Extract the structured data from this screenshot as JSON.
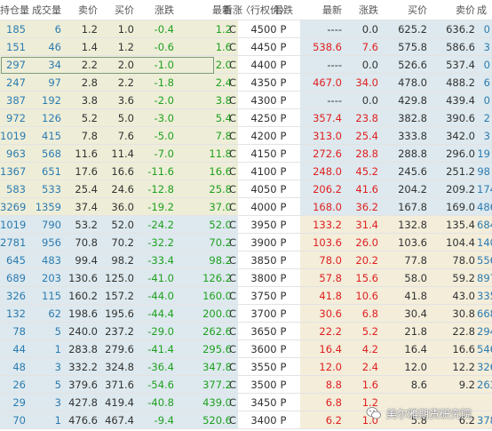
{
  "headers": [
    "持仓量",
    "成交量",
    "卖价",
    "买价",
    "涨跌",
    "最新",
    "看涨",
    "〈行权价〉",
    "看跌",
    "最新",
    "涨跌",
    "买价",
    "卖价",
    "成"
  ],
  "rows": [
    {
      "cOI": "185",
      "cVol": "6",
      "cAsk": "1.2",
      "cBid": "1.0",
      "cChg": "-0.4",
      "cLast": "1.2",
      "c": "C",
      "k": "4500",
      "p": "P",
      "pLast": "----",
      "pChg": "0.0",
      "pBid": "625.2",
      "pAsk": "636.2",
      "pVol": "0"
    },
    {
      "cOI": "151",
      "cVol": "46",
      "cAsk": "1.4",
      "cBid": "1.2",
      "cChg": "-0.6",
      "cLast": "1.6",
      "c": "C",
      "k": "4450",
      "p": "P",
      "pLast": "538.6",
      "pChg": "7.6",
      "pBid": "575.8",
      "pAsk": "586.6",
      "pVol": "3"
    },
    {
      "cOI": "297",
      "cVol": "34",
      "cAsk": "2.2",
      "cBid": "2.0",
      "cChg": "-1.0",
      "cLast": "2.0",
      "c": "C",
      "k": "4400",
      "p": "P",
      "pLast": "----",
      "pChg": "0.0",
      "pBid": "526.6",
      "pAsk": "537.4",
      "pVol": "0"
    },
    {
      "cOI": "247",
      "cVol": "97",
      "cAsk": "2.8",
      "cBid": "2.2",
      "cChg": "-1.8",
      "cLast": "2.4",
      "c": "C",
      "k": "4350",
      "p": "P",
      "pLast": "467.0",
      "pChg": "34.0",
      "pBid": "478.0",
      "pAsk": "488.2",
      "pVol": "6"
    },
    {
      "cOI": "387",
      "cVol": "192",
      "cAsk": "3.8",
      "cBid": "3.6",
      "cChg": "-2.0",
      "cLast": "3.8",
      "c": "C",
      "k": "4300",
      "p": "P",
      "pLast": "----",
      "pChg": "0.0",
      "pBid": "429.8",
      "pAsk": "439.4",
      "pVol": "0"
    },
    {
      "cOI": "972",
      "cVol": "126",
      "cAsk": "5.2",
      "cBid": "5.0",
      "cChg": "-3.0",
      "cLast": "5.4",
      "c": "C",
      "k": "4250",
      "p": "P",
      "pLast": "357.4",
      "pChg": "23.8",
      "pBid": "382.8",
      "pAsk": "390.6",
      "pVol": "2"
    },
    {
      "cOI": "1019",
      "cVol": "415",
      "cAsk": "7.8",
      "cBid": "7.6",
      "cChg": "-5.0",
      "cLast": "7.8",
      "c": "C",
      "k": "4200",
      "p": "P",
      "pLast": "313.0",
      "pChg": "25.4",
      "pBid": "333.8",
      "pAsk": "342.0",
      "pVol": "3"
    },
    {
      "cOI": "963",
      "cVol": "568",
      "cAsk": "11.6",
      "cBid": "11.4",
      "cChg": "-7.0",
      "cLast": "11.8",
      "c": "C",
      "k": "4150",
      "p": "P",
      "pLast": "272.6",
      "pChg": "28.8",
      "pBid": "288.8",
      "pAsk": "296.0",
      "pVol": "19"
    },
    {
      "cOI": "1367",
      "cVol": "651",
      "cAsk": "17.6",
      "cBid": "16.6",
      "cChg": "-11.6",
      "cLast": "16.6",
      "c": "C",
      "k": "4100",
      "p": "P",
      "pLast": "248.0",
      "pChg": "45.2",
      "pBid": "245.6",
      "pAsk": "251.2",
      "pVol": "98"
    },
    {
      "cOI": "583",
      "cVol": "533",
      "cAsk": "25.4",
      "cBid": "24.6",
      "cChg": "-12.8",
      "cLast": "25.8",
      "c": "C",
      "k": "4050",
      "p": "P",
      "pLast": "206.2",
      "pChg": "41.6",
      "pBid": "204.2",
      "pAsk": "209.2",
      "pVol": "174"
    },
    {
      "cOI": "3269",
      "cVol": "1359",
      "cAsk": "37.4",
      "cBid": "36.0",
      "cChg": "-19.2",
      "cLast": "37.0",
      "c": "C",
      "k": "4000",
      "p": "P",
      "pLast": "168.0",
      "pChg": "36.2",
      "pBid": "167.8",
      "pAsk": "169.0",
      "pVol": "486"
    },
    {
      "cOI": "1019",
      "cVol": "790",
      "cAsk": "53.2",
      "cBid": "52.0",
      "cChg": "-24.2",
      "cLast": "52.0",
      "c": "C",
      "k": "3950",
      "p": "P",
      "pLast": "133.2",
      "pChg": "31.4",
      "pBid": "132.8",
      "pAsk": "135.4",
      "pVol": "684"
    },
    {
      "cOI": "2781",
      "cVol": "956",
      "cAsk": "70.8",
      "cBid": "70.2",
      "cChg": "-32.2",
      "cLast": "70.2",
      "c": "C",
      "k": "3900",
      "p": "P",
      "pLast": "103.6",
      "pChg": "26.0",
      "pBid": "103.6",
      "pAsk": "104.4",
      "pVol": "1400"
    },
    {
      "cOI": "645",
      "cVol": "483",
      "cAsk": "99.4",
      "cBid": "98.2",
      "cChg": "-33.4",
      "cLast": "98.2",
      "c": "C",
      "k": "3850",
      "p": "P",
      "pLast": "78.0",
      "pChg": "20.2",
      "pBid": "77.8",
      "pAsk": "78.0",
      "pVol": "556"
    },
    {
      "cOI": "689",
      "cVol": "203",
      "cAsk": "130.6",
      "cBid": "125.0",
      "cChg": "-41.0",
      "cLast": "126.2",
      "c": "C",
      "k": "3800",
      "p": "P",
      "pLast": "57.8",
      "pChg": "15.6",
      "pBid": "58.0",
      "pAsk": "59.2",
      "pVol": "897"
    },
    {
      "cOI": "326",
      "cVol": "115",
      "cAsk": "160.2",
      "cBid": "157.2",
      "cChg": "-44.0",
      "cLast": "160.0",
      "c": "C",
      "k": "3750",
      "p": "P",
      "pLast": "41.8",
      "pChg": "10.6",
      "pBid": "41.8",
      "pAsk": "43.0",
      "pVol": "335"
    },
    {
      "cOI": "132",
      "cVol": "62",
      "cAsk": "198.6",
      "cBid": "195.6",
      "cChg": "-44.4",
      "cLast": "200.0",
      "c": "C",
      "k": "3700",
      "p": "P",
      "pLast": "30.6",
      "pChg": "6.8",
      "pBid": "30.4",
      "pAsk": "30.8",
      "pVol": "668"
    },
    {
      "cOI": "78",
      "cVol": "5",
      "cAsk": "240.0",
      "cBid": "237.2",
      "cChg": "-29.0",
      "cLast": "262.6",
      "c": "C",
      "k": "3650",
      "p": "P",
      "pLast": "22.2",
      "pChg": "5.2",
      "pBid": "21.8",
      "pAsk": "22.8",
      "pVol": "294"
    },
    {
      "cOI": "44",
      "cVol": "1",
      "cAsk": "283.8",
      "cBid": "279.6",
      "cChg": "-41.4",
      "cLast": "295.6",
      "c": "C",
      "k": "3600",
      "p": "P",
      "pLast": "16.4",
      "pChg": "4.2",
      "pBid": "16.4",
      "pAsk": "16.6",
      "pVol": "546"
    },
    {
      "cOI": "48",
      "cVol": "3",
      "cAsk": "332.2",
      "cBid": "324.8",
      "cChg": "-36.4",
      "cLast": "347.8",
      "c": "C",
      "k": "3550",
      "p": "P",
      "pLast": "12.0",
      "pChg": "2.4",
      "pBid": "12.0",
      "pAsk": "12.2",
      "pVol": "326"
    },
    {
      "cOI": "26",
      "cVol": "5",
      "cAsk": "379.6",
      "cBid": "371.6",
      "cChg": "-54.6",
      "cLast": "377.2",
      "c": "C",
      "k": "3500",
      "p": "P",
      "pLast": "8.8",
      "pChg": "1.6",
      "pBid": "8.6",
      "pAsk": "9.2",
      "pVol": "263"
    },
    {
      "cOI": "29",
      "cVol": "3",
      "cAsk": "427.8",
      "cBid": "419.4",
      "cChg": "-40.8",
      "cLast": "439.0",
      "c": "C",
      "k": "3450",
      "p": "P",
      "pLast": "6.8",
      "pChg": "1.2",
      "pBid": "",
      "pAsk": "",
      "pVol": ""
    },
    {
      "cOI": "70",
      "cVol": "1",
      "cAsk": "476.6",
      "cBid": "467.4",
      "cChg": "-9.4",
      "cLast": "520.6",
      "c": "C",
      "k": "3400",
      "p": "P",
      "pLast": "6.2",
      "pChg": "1.0",
      "pBid": "5.8",
      "pAsk": "6.2",
      "pVol": "378"
    }
  ],
  "watermark": {
    "text": "美尔雅期货研究院",
    "icon": "wechat-icon"
  },
  "colors": {
    "callOTM": "#eeeed8",
    "putITM": "#dde9ee",
    "callITM": "#dde9ee",
    "putOTM": "#f3edda",
    "up": "#e02020",
    "down": "#20a020",
    "oi": "#2c7bb0"
  }
}
